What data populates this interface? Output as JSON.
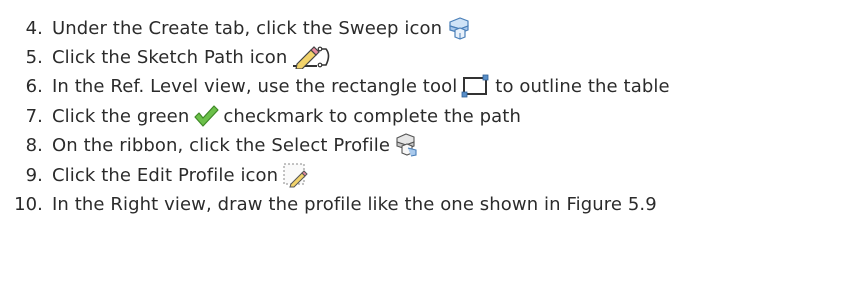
{
  "steps": [
    {
      "number": "4.",
      "before": "Under the Create tab, click the Sweep icon",
      "icon": "sweep-icon",
      "after": ""
    },
    {
      "number": "5.",
      "before": "Click the Sketch Path icon",
      "icon": "sketch-path-icon",
      "after": ""
    },
    {
      "number": "6.",
      "before": "In the Ref. Level view, use the rectangle tool",
      "icon": "rectangle-tool-icon",
      "after": "to outline the table"
    },
    {
      "number": "7.",
      "before": "Click the green",
      "icon": "green-checkmark-icon",
      "after": "checkmark to complete the path"
    },
    {
      "number": "8.",
      "before": "On the ribbon, click the Select Profile",
      "icon": "select-profile-icon",
      "after": ""
    },
    {
      "number": "9.",
      "before": "Click the Edit Profile icon",
      "icon": "edit-profile-icon",
      "after": ""
    },
    {
      "number": "10.",
      "before": "In the Right view, draw the profile like the one shown in Figure 5.9",
      "icon": "",
      "after": ""
    }
  ],
  "colors": {
    "text": "#2b2b2b",
    "checkmark_green": "#6cc04a",
    "icon_blue": "#5a8fc8"
  }
}
